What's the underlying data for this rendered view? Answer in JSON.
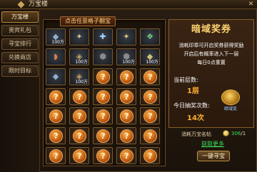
{
  "window": {
    "title": "万宝楼",
    "close": "✕"
  },
  "sidebar": {
    "items": [
      {
        "label": "万宝楼",
        "active": true
      },
      {
        "label": "贵宾礼包"
      },
      {
        "label": "寻宝排行"
      },
      {
        "label": "兑换商店"
      },
      {
        "label": "限时目标"
      }
    ]
  },
  "grid": {
    "header": "点击任意格子翻宝",
    "cells": [
      {
        "glyph": "◆",
        "qty": "100万",
        "color": "#8fb0d0"
      },
      {
        "glyph": "✦",
        "qty": "",
        "color": "#d0c090"
      },
      {
        "glyph": "✚",
        "qty": "",
        "color": "#a0d0ff"
      },
      {
        "glyph": "✦",
        "qty": "",
        "color": "#e0c070"
      },
      {
        "glyph": "❖",
        "qty": "",
        "color": "#6ad080"
      },
      {
        "glyph": "◗",
        "qty": "",
        "color": "#d08050"
      },
      {
        "glyph": "◈",
        "qty": "100万",
        "color": "#c0a060"
      },
      {
        "glyph": "⬢",
        "qty": "",
        "color": "#8a8a90"
      },
      {
        "glyph": "⬢",
        "qty": "100万",
        "color": "#8a8a90"
      },
      {
        "glyph": "◆",
        "qty": "100万",
        "color": "#d0c070"
      },
      {
        "glyph": "◆",
        "qty": "",
        "color": "#8fb0d0"
      },
      {
        "glyph": "◈",
        "qty": "100万",
        "color": "#c0a060"
      },
      {
        "orb": "?"
      },
      {
        "orb": "?"
      },
      {
        "orb": "?"
      },
      {
        "orb": "?"
      },
      {
        "orb": "?"
      },
      {
        "orb": "?"
      },
      {
        "orb": "?"
      },
      {
        "orb": "?"
      },
      {
        "orb": "?"
      },
      {
        "orb": "?"
      },
      {
        "orb": "?"
      },
      {
        "orb": "?"
      },
      {
        "orb": "?"
      },
      {
        "orb": "?"
      },
      {
        "orb": "?"
      },
      {
        "orb": "?"
      },
      {
        "orb": "?"
      },
      {
        "orb": "?"
      },
      {
        "orb": "?"
      },
      {
        "orb": "?"
      },
      {
        "orb": "?"
      },
      {
        "orb": "?"
      },
      {
        "orb": "?"
      }
    ]
  },
  "info": {
    "title": "暗域奖券",
    "desc_lines": [
      "消耗印章可开启奖券获得奖励",
      "开启后有概率进入下一层",
      "每日0点重置"
    ],
    "current_layer_label": "当前层数:",
    "current_layer_value": "1层",
    "draws_label": "今日抽奖次数:",
    "draws_value": "14次",
    "chest_caption": "暗域奖"
  },
  "footer": {
    "cost_label": "消耗万宝名帖",
    "have": "306",
    "need": "/1",
    "get_more": "获取更多",
    "search_button": "一键寻宝"
  },
  "colors": {
    "accent": "#ffd470",
    "positive": "#34e05a",
    "highlight": "#ffb030"
  }
}
